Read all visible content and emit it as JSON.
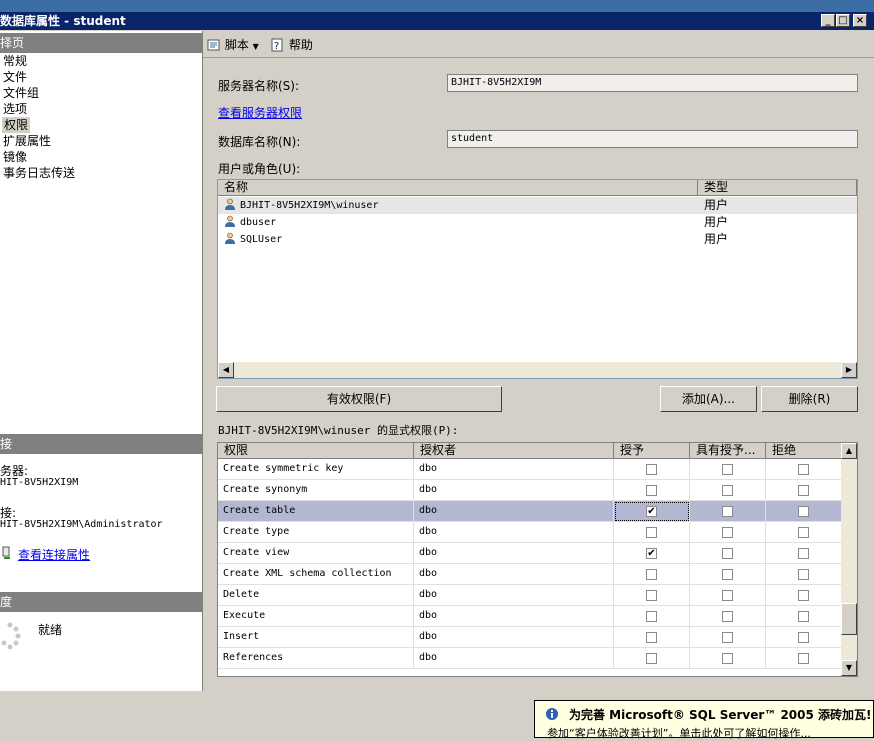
{
  "window": {
    "title": "数据库属性 - student"
  },
  "left_panel": {
    "pages_header": "择页",
    "pages": [
      "常规",
      "文件",
      "文件组",
      "选项",
      "权限",
      "扩展属性",
      "镜像",
      "事务日志传送"
    ],
    "selected_page": "权限",
    "connection_header": "接",
    "server_label": "务器:",
    "server_value": "HIT-8V5H2XI9M",
    "connection_label": "接:",
    "connection_value": "HIT-8V5H2XI9M\\Administrator",
    "view_connection_link": "查看连接属性",
    "progress_header": "度",
    "status": "就绪"
  },
  "toolbar": {
    "script_label": "脚本",
    "help_label": "帮助"
  },
  "form": {
    "server_name_label": "服务器名称(S):",
    "server_name_value": "BJHIT-8V5H2XI9M",
    "view_server_permissions_link": "查看服务器权限",
    "database_name_label": "数据库名称(N):",
    "database_name_value": "student",
    "users_roles_label": "用户或角色(U):"
  },
  "users_table": {
    "columns": [
      "名称",
      "类型"
    ],
    "rows": [
      {
        "name": "BJHIT-8V5H2XI9M\\winuser",
        "type": "用户"
      },
      {
        "name": "dbuser",
        "type": "用户"
      },
      {
        "name": "SQLUser",
        "type": "用户"
      }
    ]
  },
  "buttons": {
    "effective": "有效权限(F)",
    "add": "添加(A)...",
    "remove": "删除(R)"
  },
  "permissions": {
    "label": "BJHIT-8V5H2XI9M\\winuser 的显式权限(P):",
    "columns": [
      "权限",
      "授权者",
      "授予",
      "具有授予...",
      "拒绝"
    ],
    "rows": [
      {
        "perm": "Create symmetric key",
        "grantor": "dbo",
        "grant": false,
        "with_grant": false,
        "deny": false
      },
      {
        "perm": "Create synonym",
        "grantor": "dbo",
        "grant": false,
        "with_grant": false,
        "deny": false
      },
      {
        "perm": "Create table",
        "grantor": "dbo",
        "grant": true,
        "with_grant": false,
        "deny": false
      },
      {
        "perm": "Create type",
        "grantor": "dbo",
        "grant": false,
        "with_grant": false,
        "deny": false
      },
      {
        "perm": "Create view",
        "grantor": "dbo",
        "grant": true,
        "with_grant": false,
        "deny": false
      },
      {
        "perm": "Create XML schema collection",
        "grantor": "dbo",
        "grant": false,
        "with_grant": false,
        "deny": false
      },
      {
        "perm": "Delete",
        "grantor": "dbo",
        "grant": false,
        "with_grant": false,
        "deny": false
      },
      {
        "perm": "Execute",
        "grantor": "dbo",
        "grant": false,
        "with_grant": false,
        "deny": false
      },
      {
        "perm": "Insert",
        "grantor": "dbo",
        "grant": false,
        "with_grant": false,
        "deny": false
      },
      {
        "perm": "References",
        "grantor": "dbo",
        "grant": false,
        "with_grant": false,
        "deny": false
      }
    ],
    "selected_row": "Create table"
  },
  "notification": {
    "title": "为完善 Microsoft® SQL Server™ 2005 添砖加瓦!",
    "body": "参加“客户体验改善计划”。单击此处可了解如何操作..."
  },
  "colors": {
    "title_bar": "#0a246a",
    "selection": "#b4b7d2",
    "link": "#0000ee"
  }
}
